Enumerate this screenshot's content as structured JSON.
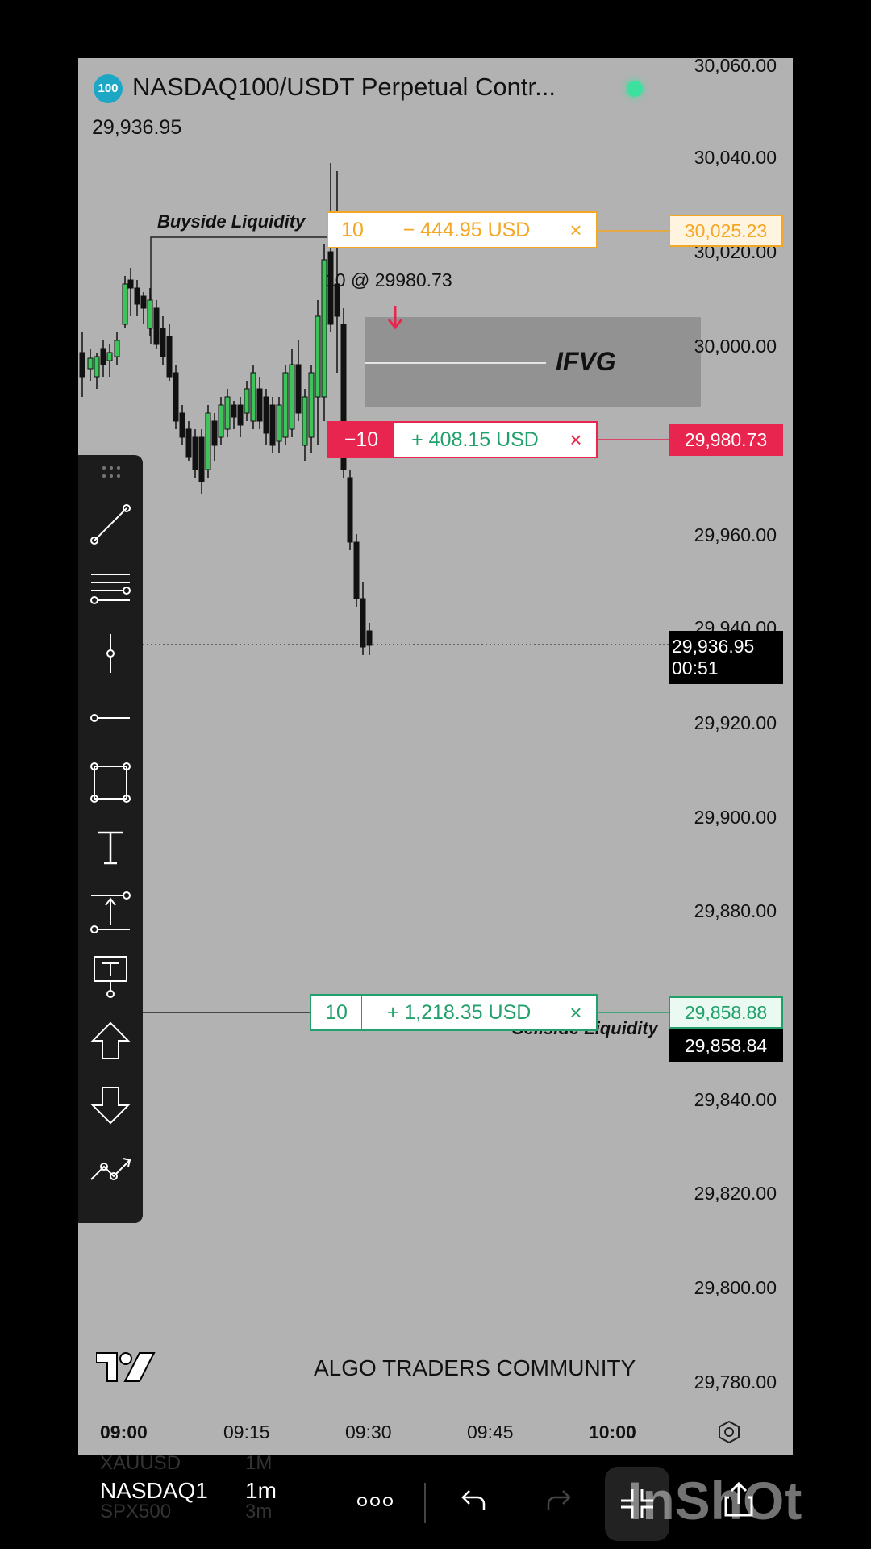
{
  "header": {
    "logo_text": "100",
    "title": "NASDAQ100/USDT Perpetual Contr...",
    "price": "29,936.95"
  },
  "price_axis": [
    "30,060.00",
    "30,040.00",
    "30,020.00",
    "30,000.00",
    "29,960.00",
    "29,940.00",
    "29,920.00",
    "29,900.00",
    "29,880.00",
    "29,840.00",
    "29,820.00",
    "29,800.00",
    "29,780.00"
  ],
  "time_axis": [
    "09:00",
    "09:15",
    "09:30",
    "09:45",
    "10:00"
  ],
  "annotations": {
    "buyside": "Buyside Liquidity",
    "sellside": "Sellside Liquidity",
    "ifvg": "IFVG",
    "fill": "10 @ 29980.73",
    "watermark": "ALGO TRADERS COMMUNITY"
  },
  "orders": {
    "take_profit_upper": {
      "qty": "10",
      "pnl": "− 444.95 USD",
      "price": "30,025.23",
      "color": "#f5a623"
    },
    "position": {
      "qty": "−10",
      "pnl": "+ 408.15 USD",
      "price": "29,980.73",
      "color": "#e8254f"
    },
    "take_profit_lower": {
      "qty": "10",
      "pnl": "+ 1,218.35 USD",
      "price": "29,858.88",
      "color": "#22a06b"
    },
    "close_symbol": "×"
  },
  "current_price": {
    "price": "29,936.95",
    "countdown": "00:51"
  },
  "sellside_price": "29,858.84",
  "toolbar": [
    "trend-line-icon",
    "horizontal-lines-icon",
    "vertical-line-icon",
    "horizontal-ray-icon",
    "rectangle-icon",
    "text-icon",
    "price-range-icon",
    "callout-text-icon",
    "arrow-up-icon",
    "arrow-down-icon",
    "path-icon"
  ],
  "bottom": {
    "symbol": "NASDAQ1",
    "interval": "1m",
    "ghost_top_symbol": "XAUUSD",
    "ghost_top_interval": "1M",
    "ghost_bottom_symbol": "SPX500",
    "ghost_bottom_interval": "3m",
    "app_watermark": "InShOt"
  }
}
